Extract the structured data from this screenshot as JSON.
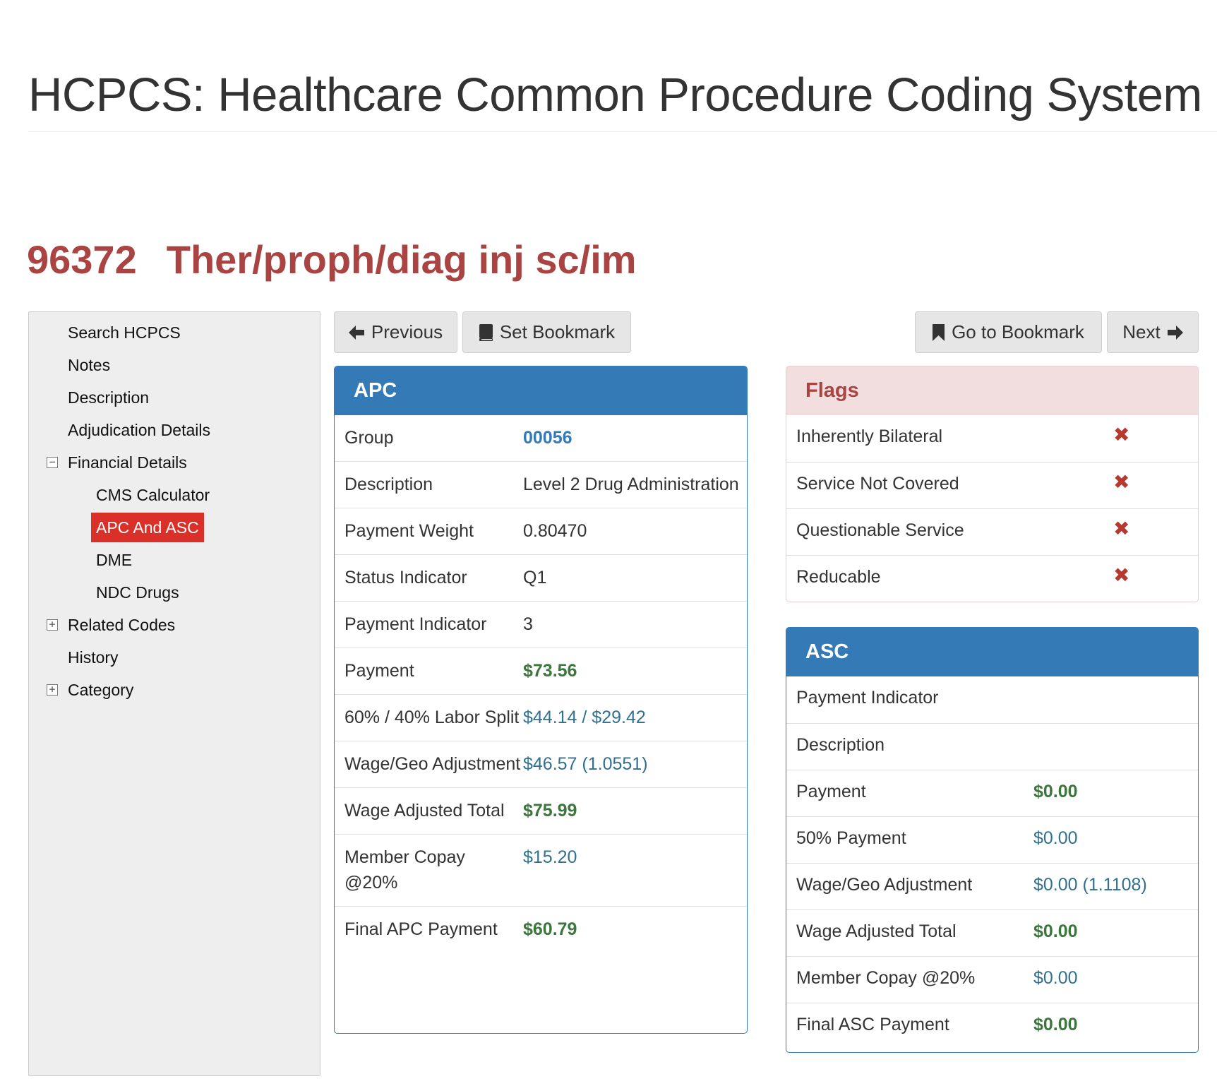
{
  "page": {
    "title": "HCPCS: Healthcare Common Procedure Coding System",
    "code": "96372",
    "code_description": "Ther/proph/diag inj sc/im"
  },
  "sidebar": {
    "items": [
      {
        "label": "Search HCPCS"
      },
      {
        "label": "Notes"
      },
      {
        "label": "Description"
      },
      {
        "label": "Adjudication Details"
      },
      {
        "label": "Financial Details",
        "toggle": "−",
        "expanded": true
      },
      {
        "label": "CMS Calculator"
      },
      {
        "label": "APC And ASC",
        "active": true
      },
      {
        "label": "DME"
      },
      {
        "label": "NDC Drugs"
      },
      {
        "label": "Related Codes",
        "toggle": "+",
        "expanded": false
      },
      {
        "label": "History"
      },
      {
        "label": "Category",
        "toggle": "+",
        "expanded": false
      }
    ]
  },
  "nav": {
    "previous": "Previous",
    "set_bookmark": "Set Bookmark",
    "go_to_bookmark": "Go to Bookmark",
    "next": "Next"
  },
  "apc": {
    "title": "APC",
    "rows": [
      {
        "key": "Group",
        "value": "00056",
        "style": "link"
      },
      {
        "key": "Description",
        "value": "Level 2 Drug Administration",
        "style": "plain"
      },
      {
        "key": "Payment Weight",
        "value": "0.80470",
        "style": "plain"
      },
      {
        "key": "Status Indicator",
        "value": "Q1",
        "style": "plain"
      },
      {
        "key": "Payment Indicator",
        "value": "3",
        "style": "plain"
      },
      {
        "key": "Payment",
        "value": "$73.56",
        "style": "money"
      },
      {
        "key": "60% / 40% Labor Split",
        "value": "$44.14 / $29.42",
        "style": "info"
      },
      {
        "key": "Wage/Geo Adjustment",
        "value": "$46.57 (1.0551)",
        "style": "info"
      },
      {
        "key": "Wage Adjusted Total",
        "value": "$75.99",
        "style": "money"
      },
      {
        "key": "Member Copay @20%",
        "value": "$15.20",
        "style": "info"
      },
      {
        "key": "Final APC Payment",
        "value": "$60.79",
        "style": "money"
      }
    ]
  },
  "flags": {
    "title": "Flags",
    "rows": [
      {
        "label": "Inherently Bilateral",
        "mark": "✖"
      },
      {
        "label": "Service Not Covered",
        "mark": "✖"
      },
      {
        "label": "Questionable Service",
        "mark": "✖"
      },
      {
        "label": "Reducable",
        "mark": "✖"
      }
    ]
  },
  "asc": {
    "title": "ASC",
    "rows": [
      {
        "key": "Payment Indicator",
        "value": "",
        "style": "plain"
      },
      {
        "key": "Description",
        "value": "",
        "style": "plain"
      },
      {
        "key": "Payment",
        "value": "$0.00",
        "style": "money"
      },
      {
        "key": "50% Payment",
        "value": "$0.00",
        "style": "info"
      },
      {
        "key": "Wage/Geo Adjustment",
        "value": "$0.00 (1.1108)",
        "style": "info"
      },
      {
        "key": "Wage Adjusted Total",
        "value": "$0.00",
        "style": "money"
      },
      {
        "key": "Member Copay @20%",
        "value": "$0.00",
        "style": "info"
      },
      {
        "key": "Final ASC Payment",
        "value": "$0.00",
        "style": "money"
      }
    ]
  },
  "colors": {
    "primary": "#337ab7",
    "danger_text": "#a94442",
    "success_text": "#3c763d",
    "info_text": "#31708f",
    "active_nav": "#d9302a"
  }
}
